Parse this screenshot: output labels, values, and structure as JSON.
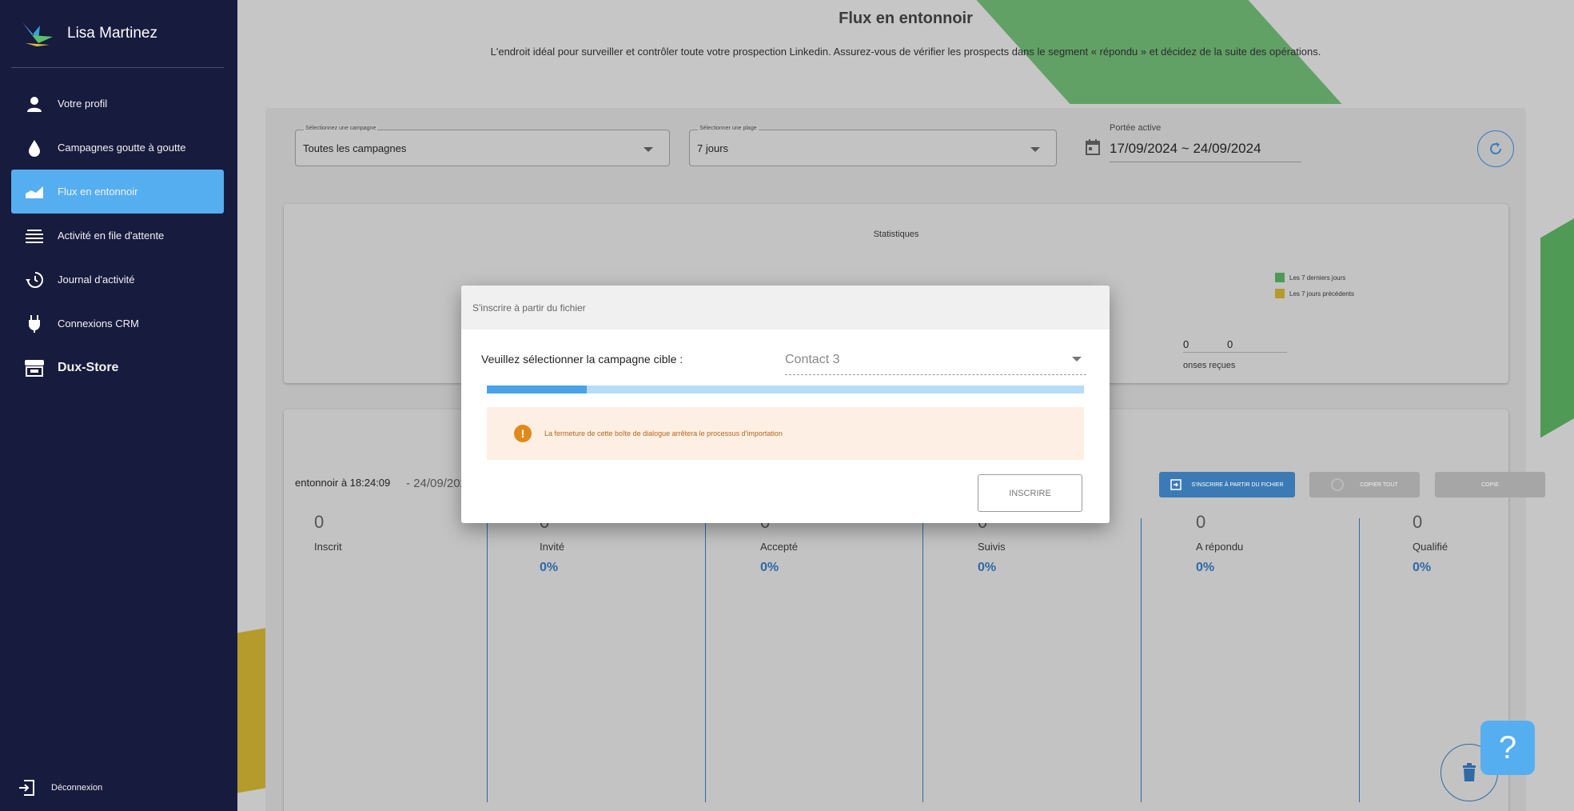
{
  "user": {
    "name": "Lisa Martinez"
  },
  "sidebar": {
    "items": [
      {
        "label": "Votre profil",
        "icon": "user-icon"
      },
      {
        "label": "Campagnes goutte à goutte",
        "icon": "drop-icon"
      },
      {
        "label": "Flux en entonnoir",
        "icon": "trend-icon",
        "active": true
      },
      {
        "label": "Activité en file d'attente",
        "icon": "queue-icon"
      },
      {
        "label": "Journal d'activité",
        "icon": "history-icon"
      },
      {
        "label": "Connexions CRM",
        "icon": "plug-icon"
      },
      {
        "label": "Dux-Store",
        "icon": "store-icon"
      }
    ],
    "logout_label": "Déconnexion"
  },
  "page": {
    "title": "Flux en entonnoir",
    "subtitle": "L'endroit idéal pour surveiller et contrôler toute votre prospection Linkedin. Assurez-vous de vérifier les prospects dans le segment « répondu » et décidez de la suite des opérations."
  },
  "filters": {
    "campaign_label": "Sélectionnez une campagne",
    "campaign_value": "Toutes les campagnes",
    "range_label": "Sélectionner une plage",
    "range_value": "7 jours",
    "active_label": "Portée active",
    "active_value": "17/09/2024 ~ 24/09/2024"
  },
  "stats": {
    "title": "Statistiques",
    "legend": [
      {
        "label": "Les 7 derniers jours",
        "color": "#4f9a55"
      },
      {
        "label": "Les 7 jours précédents",
        "color": "#b59a2c"
      }
    ],
    "value_a": "0",
    "value_b": "0",
    "responses_label": "onses reçues"
  },
  "funnel": {
    "caption": "entonnoir à 18:24:09",
    "date": "- 24/09/2024",
    "buttons": {
      "import": "S'inscrire à partir du fichier",
      "copy_all": "Copier tout",
      "copy": "Copie"
    },
    "columns": [
      {
        "value": "0",
        "label": "Inscrit",
        "pct": ""
      },
      {
        "value": "0",
        "label": "Invité",
        "pct": "0%"
      },
      {
        "value": "0",
        "label": "Accepté",
        "pct": "0%"
      },
      {
        "value": "0",
        "label": "Suivis",
        "pct": "0%"
      },
      {
        "value": "0",
        "label": "A répondu",
        "pct": "0%"
      },
      {
        "value": "0",
        "label": "Qualifié",
        "pct": "0%"
      }
    ]
  },
  "modal": {
    "title": "S'inscrire à partir du fichier",
    "campaign_label": "Veuillez sélectionner la campagne cible :",
    "campaign_value": "Contact 3",
    "progress": 0.167,
    "warning": "La fermeture de cette boîte de dialogue arrêtera le processus d'importation",
    "submit_label": "Inscrire"
  },
  "help_label": "?",
  "colors": {
    "sidebar": "#171b3d",
    "accent": "#55aef0",
    "primary": "#2f6aa5"
  }
}
